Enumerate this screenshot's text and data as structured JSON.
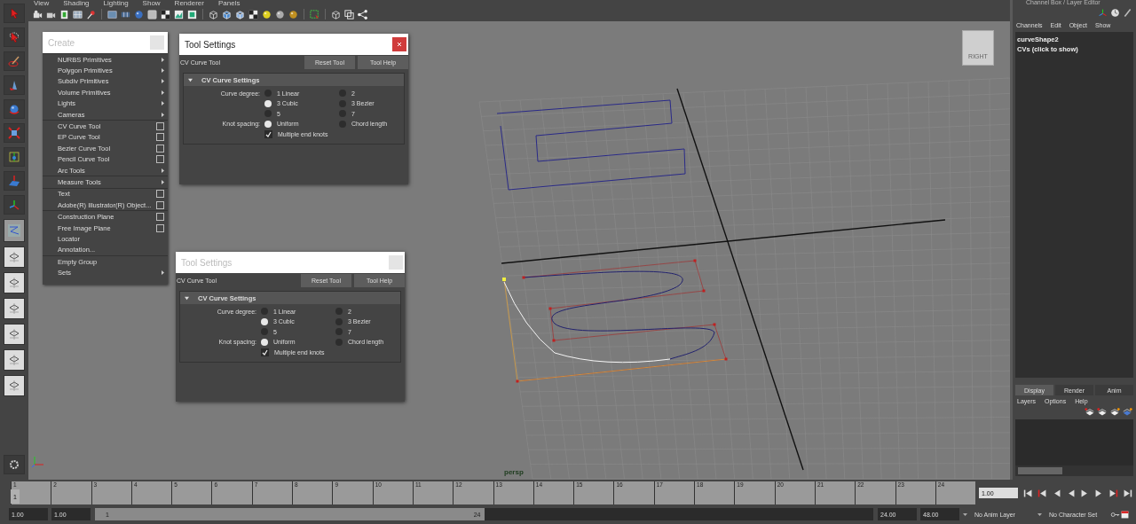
{
  "menubar": [
    "View",
    "Shading",
    "Lighting",
    "Show",
    "Renderer",
    "Panels"
  ],
  "viewport": {
    "camera_label": "persp",
    "view_cube_label": "RIGHT"
  },
  "create_menu": {
    "title": "Create",
    "groups": [
      [
        {
          "label": "NURBS Primitives",
          "kind": "submenu"
        },
        {
          "label": "Polygon Primitives",
          "kind": "submenu"
        },
        {
          "label": "Subdiv Primitives",
          "kind": "submenu"
        },
        {
          "label": "Volume Primitives",
          "kind": "submenu"
        },
        {
          "label": "Lights",
          "kind": "submenu"
        },
        {
          "label": "Cameras",
          "kind": "submenu"
        }
      ],
      [
        {
          "label": "CV Curve Tool",
          "kind": "option"
        },
        {
          "label": "EP Curve Tool",
          "kind": "option"
        },
        {
          "label": "Bezier Curve Tool",
          "kind": "option"
        },
        {
          "label": "Pencil Curve Tool",
          "kind": "option"
        },
        {
          "label": "Arc Tools",
          "kind": "submenu"
        }
      ],
      [
        {
          "label": "Measure Tools",
          "kind": "submenu"
        }
      ],
      [
        {
          "label": "Text",
          "kind": "option"
        },
        {
          "label": "Adobe(R) Illustrator(R) Object...",
          "kind": "option"
        }
      ],
      [
        {
          "label": "Construction Plane",
          "kind": "option"
        },
        {
          "label": "Free Image Plane",
          "kind": "option"
        },
        {
          "label": "Locator",
          "kind": "plain"
        },
        {
          "label": "Annotation...",
          "kind": "plain"
        }
      ],
      [
        {
          "label": "Empty Group",
          "kind": "plain"
        },
        {
          "label": "Sets",
          "kind": "submenu"
        }
      ]
    ]
  },
  "tool_windows": [
    {
      "title": "Tool Settings",
      "active": true,
      "tool": "CV Curve Tool",
      "buttons": [
        "Reset Tool",
        "Tool Help"
      ],
      "section": {
        "title": "CV Curve Settings",
        "expanded": true
      },
      "degree_label": "Curve degree:",
      "degree_options": [
        {
          "label": "1 Linear",
          "selected": false
        },
        {
          "label": "2",
          "selected": false
        },
        {
          "label": "3 Cubic",
          "selected": true
        },
        {
          "label": "3 Bezier",
          "selected": false
        },
        {
          "label": "5",
          "selected": false
        },
        {
          "label": "7",
          "selected": false
        }
      ],
      "knot_label": "Knot spacing:",
      "knot_options": [
        {
          "label": "Uniform",
          "selected": true
        },
        {
          "label": "Chord length",
          "selected": false
        }
      ],
      "end_knots": {
        "label": "Multiple end knots",
        "checked": true
      }
    },
    {
      "title": "Tool Settings",
      "active": false,
      "tool": "CV Curve Tool",
      "buttons": [
        "Reset Tool",
        "Tool Help"
      ],
      "section": {
        "title": "CV Curve Settings",
        "expanded": true
      },
      "degree_label": "Curve degree:",
      "degree_options": [
        {
          "label": "1 Linear",
          "selected": false
        },
        {
          "label": "2",
          "selected": false
        },
        {
          "label": "3 Cubic",
          "selected": true
        },
        {
          "label": "3 Bezier",
          "selected": false
        },
        {
          "label": "5",
          "selected": false
        },
        {
          "label": "7",
          "selected": false
        }
      ],
      "knot_label": "Knot spacing:",
      "knot_options": [
        {
          "label": "Uniform",
          "selected": true
        },
        {
          "label": "Chord length",
          "selected": false
        }
      ],
      "end_knots": {
        "label": "Multiple end knots",
        "checked": true
      }
    }
  ],
  "channel_box": {
    "title": "Channel Box / Layer Editor",
    "menus": [
      "Channels",
      "Edit",
      "Object",
      "Show"
    ],
    "object": "curveShape2",
    "cvs": "CVs (click to show)"
  },
  "layer_editor": {
    "tabs": [
      {
        "label": "Display",
        "selected": true
      },
      {
        "label": "Render",
        "selected": false
      },
      {
        "label": "Anim",
        "selected": false
      }
    ],
    "menus": [
      "Layers",
      "Options",
      "Help"
    ]
  },
  "timeline": {
    "ticks": [
      "1",
      "2",
      "3",
      "4",
      "5",
      "6",
      "7",
      "8",
      "9",
      "10",
      "11",
      "12",
      "13",
      "14",
      "15",
      "16",
      "17",
      "18",
      "19",
      "20",
      "21",
      "22",
      "23",
      "24"
    ],
    "current_frame": "1",
    "level": 0,
    "current_time": "1.00"
  },
  "range": {
    "start": "1.00",
    "playback_start": "1.00",
    "slider_start": "1",
    "slider_end": "24",
    "level": 0.5,
    "playback_end": "24.00",
    "end": "48.00",
    "anim_layer": "No Anim Layer",
    "character_set": "No Character Set"
  }
}
